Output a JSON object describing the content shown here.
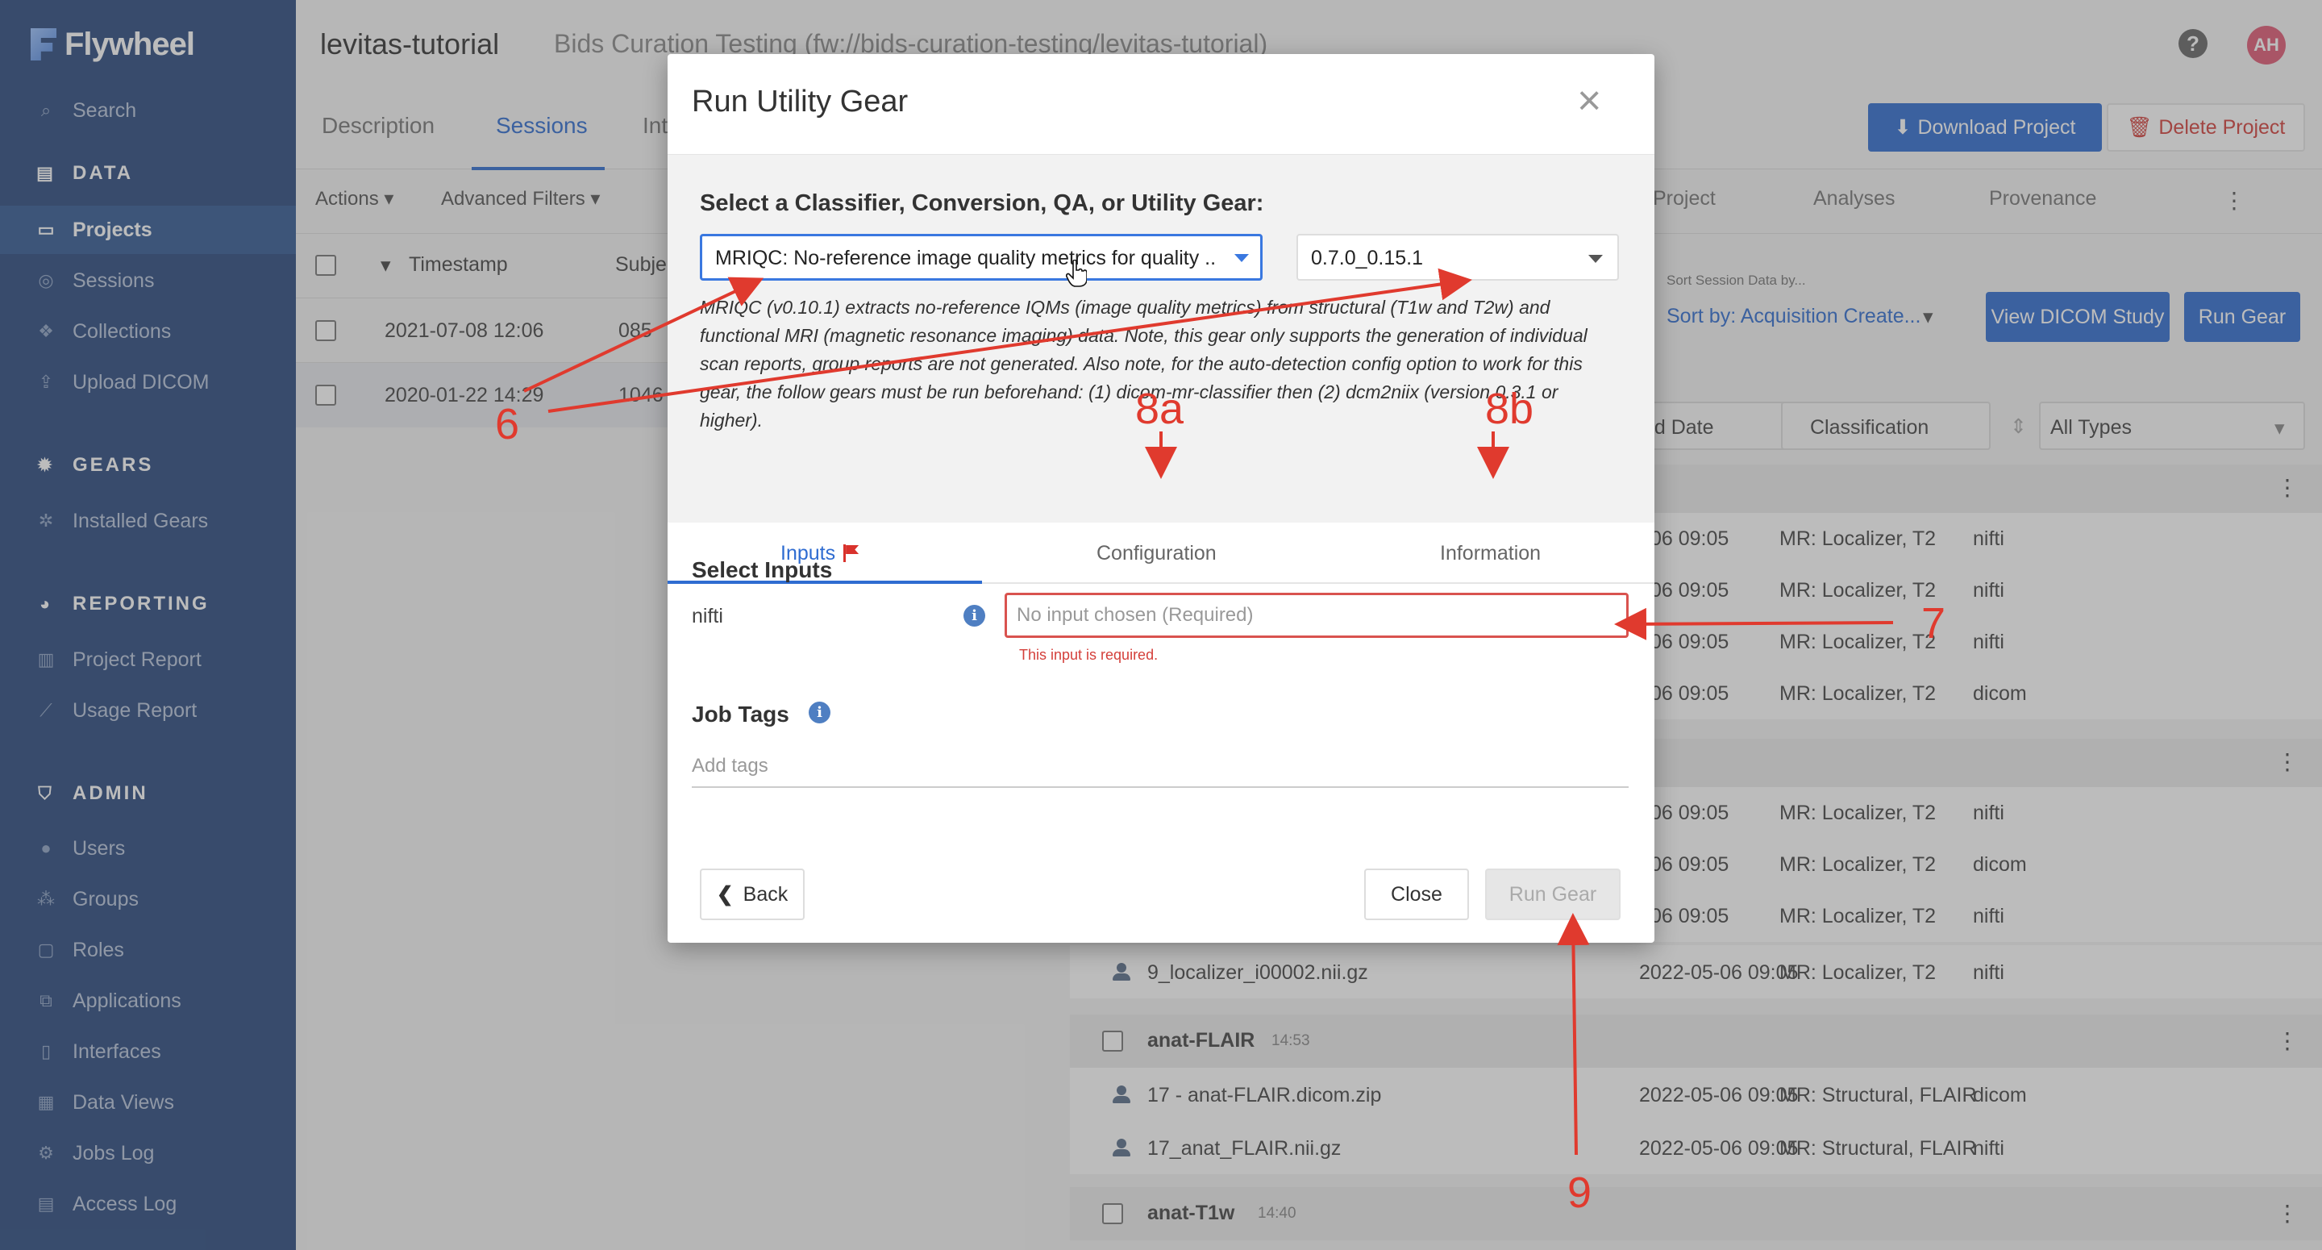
{
  "brand": {
    "name": "Flywheel"
  },
  "sidebar": {
    "search": "Search",
    "sections": [
      {
        "title": "DATA",
        "items": [
          "Projects",
          "Sessions",
          "Collections",
          "Upload DICOM"
        ]
      },
      {
        "title": "GEARS",
        "items": [
          "Installed Gears"
        ]
      },
      {
        "title": "REPORTING",
        "items": [
          "Project Report",
          "Usage Report"
        ]
      },
      {
        "title": "ADMIN",
        "items": [
          "Users",
          "Groups",
          "Roles",
          "Applications",
          "Interfaces",
          "Data Views",
          "Jobs Log",
          "Access Log"
        ]
      }
    ],
    "active_item": "Projects"
  },
  "header": {
    "project_title": "levitas-tutorial",
    "project_path": "Bids Curation Testing (fw://bids-curation-testing/levitas-tutorial)",
    "avatar_initials": "AH"
  },
  "tabs": [
    "Description",
    "Sessions",
    "Int",
    "Project",
    "Analyses",
    "Provenance"
  ],
  "active_tab": "Sessions",
  "project_buttons": {
    "download": "Download Project",
    "delete": "Delete Project"
  },
  "toolbar": {
    "actions": "Actions",
    "advanced_filters": "Advanced Filters"
  },
  "session_grid": {
    "columns": [
      "Timestamp",
      "Subje"
    ],
    "rows": [
      {
        "timestamp": "2021-07-08 12:06",
        "subject": "085"
      },
      {
        "timestamp": "2020-01-22 14:29",
        "subject": "1046"
      }
    ]
  },
  "right_panel": {
    "sort_caption": "Sort Session Data by...",
    "sort_value": "Sort by: Acquisition Create...",
    "view_dicom": "View DICOM Study",
    "run_gear": "Run Gear",
    "filter_date": "ted Date",
    "filter_classification": "Classification",
    "filter_types": "All Types"
  },
  "acquisition_rows": [
    {
      "time": "06 09:05",
      "classification": "MR: Localizer, T2",
      "type": "nifti"
    },
    {
      "time": "06 09:05",
      "classification": "MR: Localizer, T2",
      "type": "nifti"
    },
    {
      "time": "06 09:05",
      "classification": "MR: Localizer, T2",
      "type": "nifti"
    },
    {
      "time": "06 09:05",
      "classification": "MR: Localizer, T2",
      "type": "dicom"
    },
    {
      "time": "06 09:05",
      "classification": "MR: Localizer, T2",
      "type": "nifti"
    },
    {
      "time": "06 09:05",
      "classification": "MR: Localizer, T2",
      "type": "dicom"
    },
    {
      "time": "06 09:05",
      "classification": "MR: Localizer, T2",
      "type": "nifti"
    }
  ],
  "lower_list": {
    "file_row": {
      "name": "9_localizer_i00002.nii.gz",
      "date": "2022-05-06 09:05",
      "classification": "MR: Localizer, T2",
      "type": "nifti"
    },
    "group_flair": {
      "name": "anat-FLAIR",
      "time": "14:53"
    },
    "flair_files": [
      {
        "name": "17 - anat-FLAIR.dicom.zip",
        "date": "2022-05-06 09:05",
        "classification": "MR: Structural, FLAIR",
        "type": "dicom"
      },
      {
        "name": "17_anat_FLAIR.nii.gz",
        "date": "2022-05-06 09:05",
        "classification": "MR: Structural, FLAIR",
        "type": "nifti"
      }
    ],
    "group_t1w": {
      "name": "anat-T1w",
      "time": "14:40"
    }
  },
  "modal": {
    "title": "Run Utility Gear",
    "select_label": "Select a Classifier, Conversion, QA, or Utility Gear:",
    "gear_value": "MRIQC: No-reference image quality metrics for quality ...",
    "version_value": "0.7.0_0.15.1",
    "description": "MRIQC (v0.10.1) extracts no-reference IQMs (image quality metrics) from structural (T1w and T2w) and functional MRI (magnetic resonance imaging) data. Note, this gear only supports the generation of individual scan reports, group reports are not generated. Also note, for the auto-detection config option to work for this gear, the follow gears must be run beforehand: (1) dicom-mr-classifier then (2) dcm2niix (version 0.3.1 or higher).",
    "tabs": [
      "Inputs",
      "Configuration",
      "Information"
    ],
    "active_tab": "Inputs",
    "select_inputs": "Select Inputs",
    "input_name": "nifti",
    "input_placeholder": "No input chosen (Required)",
    "input_error": "This input is required.",
    "job_tags": "Job Tags",
    "tags_placeholder": "Add tags",
    "back": "Back",
    "close": "Close",
    "run": "Run Gear"
  },
  "annotations": [
    "6",
    "7",
    "8a",
    "8b",
    "9"
  ],
  "colors": {
    "sidebar": "#2a4a7e",
    "accent": "#2f6cd1",
    "annotation": "#e03a2e",
    "error": "#d9534f"
  }
}
